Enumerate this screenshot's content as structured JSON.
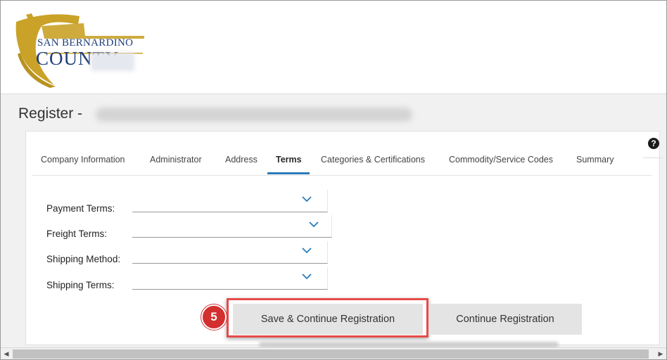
{
  "logo": {
    "line1": "SAN BERNARDINO",
    "line2": "COUNTY"
  },
  "page": {
    "title_prefix": "Register -"
  },
  "tabs": [
    {
      "label": "Company Information"
    },
    {
      "label": "Administrator"
    },
    {
      "label": "Address"
    },
    {
      "label": "Terms",
      "active": true
    },
    {
      "label": "Categories & Certifications"
    },
    {
      "label": "Commodity/Service Codes"
    },
    {
      "label": "Summary"
    }
  ],
  "help": {
    "icon": "question-circle-icon",
    "glyph": "?"
  },
  "form": {
    "payment_terms": {
      "label": "Payment Terms:",
      "value": ""
    },
    "freight_terms": {
      "label": "Freight Terms:",
      "value": ""
    },
    "shipping_method": {
      "label": "Shipping Method:",
      "value": ""
    },
    "shipping_terms": {
      "label": "Shipping Terms:",
      "value": ""
    }
  },
  "step_badge": "5",
  "buttons": {
    "save_continue": "Save & Continue Registration",
    "continue": "Continue Registration"
  },
  "scroll": {
    "left_arrow": "◀",
    "right_arrow": "▶"
  },
  "colors": {
    "accent": "#2b7bb9",
    "badge": "#d32f2f",
    "highlight": "#e84a4a",
    "logo_gold": "#c9a227",
    "logo_navy": "#1f3d7a"
  }
}
